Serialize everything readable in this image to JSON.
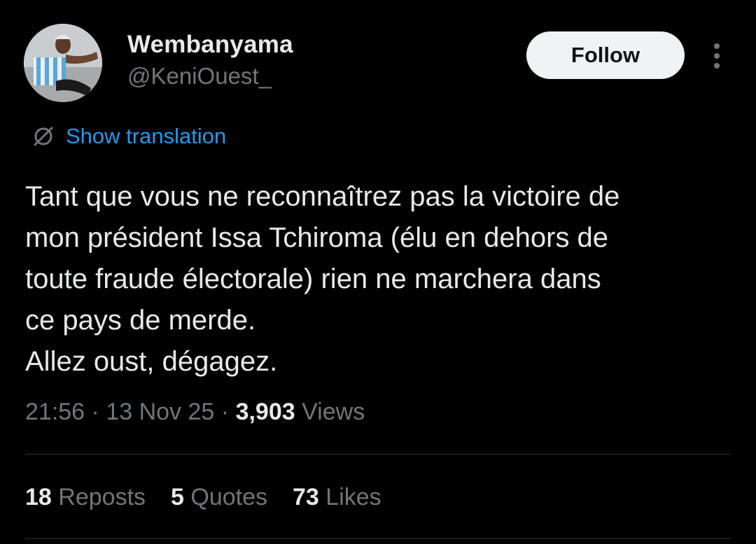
{
  "author": {
    "display_name": "Wembanyama",
    "handle": "@KeniOuest_"
  },
  "actions": {
    "follow_label": "Follow",
    "more_icon": "more-vertical-icon"
  },
  "translation": {
    "icon": "globe-icon",
    "label": "Show translation"
  },
  "tweet": {
    "text": "Tant que vous ne reconnaîtrez pas la victoire de\nmon président Issa Tchiroma (élu en dehors de\ntoute fraude électorale) rien ne marchera dans\nce pays de merde.\nAllez oust, dégagez."
  },
  "meta": {
    "time": "21:56",
    "separator": "·",
    "date": "13 Nov 25",
    "views_count": "3,903",
    "views_label": "Views"
  },
  "stats": {
    "reposts_count": "18",
    "reposts_label": "Reposts",
    "quotes_count": "5",
    "quotes_label": "Quotes",
    "likes_count": "73",
    "likes_label": "Likes"
  },
  "colors": {
    "background": "#000000",
    "text_primary": "#e7e9ea",
    "text_secondary": "#71767b",
    "link": "#1d9bf0",
    "follow_bg": "#eff3f4",
    "divider": "#2f3336"
  }
}
